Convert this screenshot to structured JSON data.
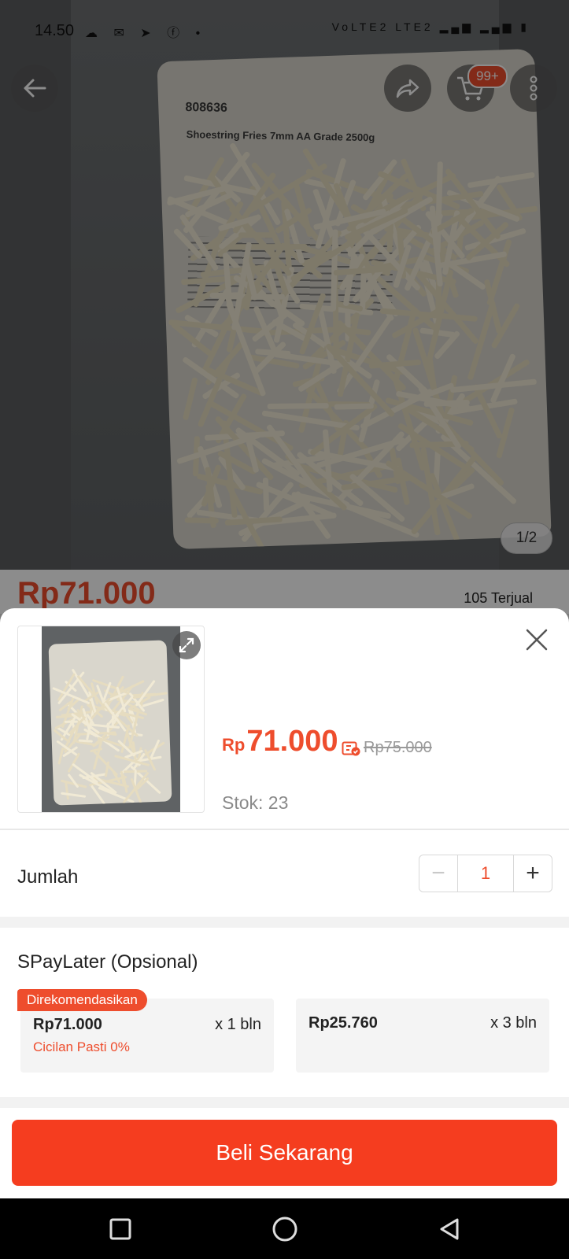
{
  "status_bar": {
    "time": "14.50",
    "network": "VoLTE2 LTE2",
    "battery_icon": "battery-charging-icon"
  },
  "product_header": {
    "cart_badge": "99+",
    "image_counter": "1/2",
    "background_price": "Rp71.000",
    "background_sold": "105 Terjual"
  },
  "product_image_text": {
    "code": "808636",
    "label": "Shoestring Fries 7mm AA Grade 2500g"
  },
  "sheet": {
    "price_currency": "Rp",
    "price_value": "71.000",
    "original_price": "Rp75.000",
    "stock": "Stok: 23",
    "quantity_label": "Jumlah",
    "quantity_value": "1",
    "minus_symbol": "−",
    "plus_symbol": "+",
    "paylater_title": "SPayLater (Opsional)",
    "recommended_badge": "Direkomendasikan",
    "plans": [
      {
        "amount": "Rp71.000",
        "tenor": "x 1 bln",
        "note": "Cicilan Pasti 0%"
      },
      {
        "amount": "Rp25.760",
        "tenor": "x 3 bln",
        "note": ""
      }
    ],
    "buy_button": "Beli Sekarang"
  },
  "colors": {
    "accent": "#ee4d2d",
    "buy_button": "#f53d1f",
    "muted_text": "#8a8a8a"
  }
}
